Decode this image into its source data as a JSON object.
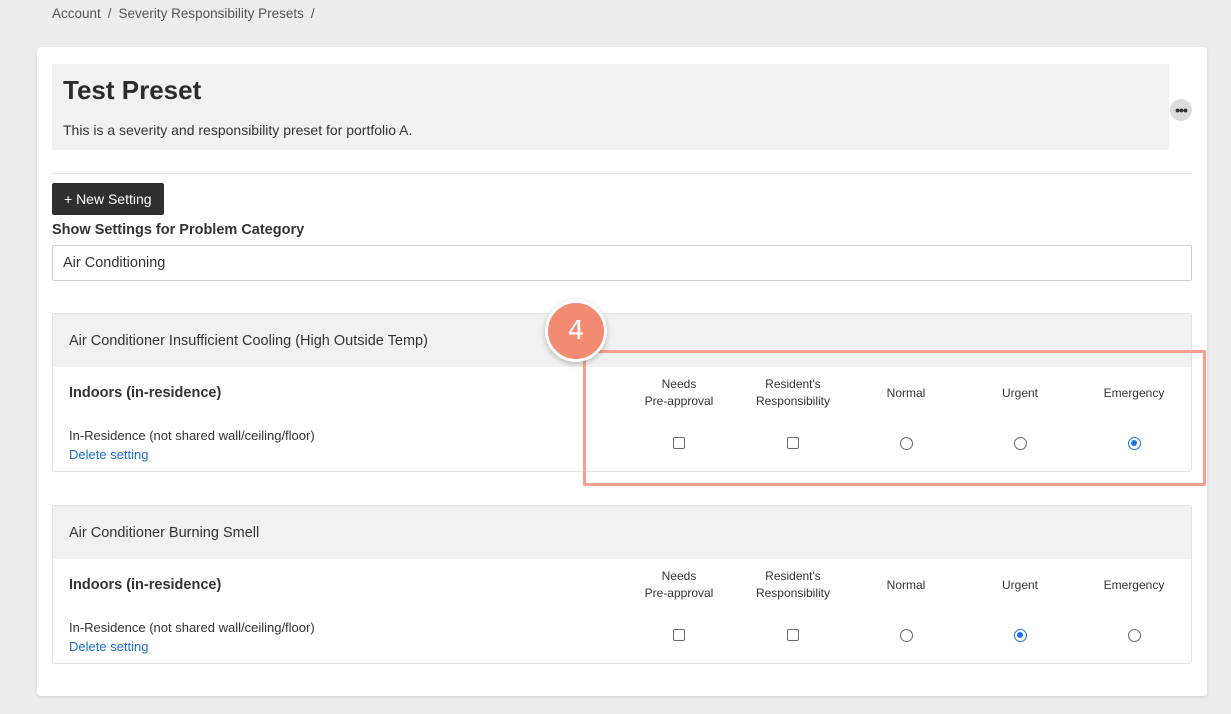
{
  "breadcrumb": {
    "items": [
      "Account",
      "Severity Responsibility Presets"
    ],
    "separator": "/"
  },
  "preset": {
    "title": "Test Preset",
    "description": "This is a severity and responsibility preset for portfolio A.",
    "more_icon": "ellipsis-icon",
    "more_glyph": "•••"
  },
  "toolbar": {
    "new_setting_label": "+ New Setting"
  },
  "filter": {
    "label": "Show Settings for Problem Category",
    "value": "Air Conditioning"
  },
  "columns": [
    "Needs\nPre-approval",
    "Resident's\nResponsibility",
    "Normal",
    "Urgent",
    "Emergency"
  ],
  "settings": [
    {
      "title": "Air Conditioner Insufficient Cooling (High Outside Temp)",
      "location_group": "Indoors (in-residence)",
      "location": "In-Residence (not shared wall/ceiling/floor)",
      "delete_label": "Delete setting",
      "needs_preapproval": false,
      "residents_responsibility": false,
      "severity": "Emergency"
    },
    {
      "title": "Air Conditioner Burning Smell",
      "location_group": "Indoors (in-residence)",
      "location": "In-Residence (not shared wall/ceiling/floor)",
      "delete_label": "Delete setting",
      "needs_preapproval": false,
      "residents_responsibility": false,
      "severity": "Urgent"
    }
  ],
  "annotation": {
    "step_number": "4",
    "color": "#f28b72"
  },
  "colors": {
    "accent": "#1a73e8",
    "link": "#1a6fc9",
    "button_dark": "#2f2f2f",
    "highlight": "#f6a08c"
  }
}
